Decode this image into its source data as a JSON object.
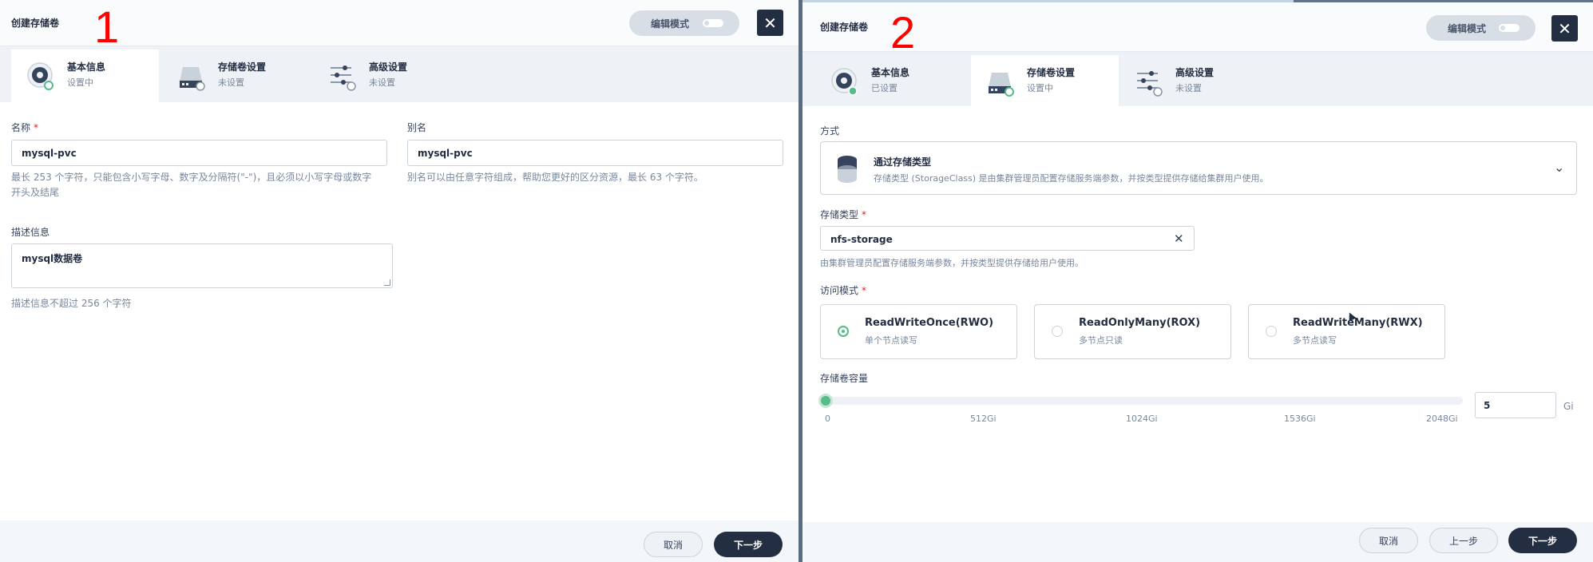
{
  "left": {
    "title": "创建存储卷",
    "marker": "1",
    "edit_mode_label": "编辑模式",
    "tabs": [
      {
        "title": "基本信息",
        "status": "设置中"
      },
      {
        "title": "存储卷设置",
        "status": "未设置"
      },
      {
        "title": "高级设置",
        "status": "未设置"
      }
    ],
    "name": {
      "label": "名称",
      "required": "*",
      "value": "mysql-pvc",
      "help_line1": "最长 253 个字符，只能包含小写字母、数字及分隔符(\"-\")，且必须以小写字母或数字",
      "help_line2": "开头及结尾"
    },
    "alias": {
      "label": "别名",
      "value": "mysql-pvc",
      "help": "别名可以由任意字符组成，帮助您更好的区分资源，最长 63 个字符。"
    },
    "description": {
      "label": "描述信息",
      "value": "mysql数据卷",
      "help": "描述信息不超过 256 个字符"
    },
    "footer": {
      "cancel": "取消",
      "next": "下一步"
    }
  },
  "right": {
    "title": "创建存储卷",
    "marker": "2",
    "edit_mode_label": "编辑模式",
    "tabs": [
      {
        "title": "基本信息",
        "status": "已设置"
      },
      {
        "title": "存储卷设置",
        "status": "设置中"
      },
      {
        "title": "高级设置",
        "status": "未设置"
      }
    ],
    "method": {
      "label": "方式",
      "title": "通过存储类型",
      "desc": "存储类型 (StorageClass) 是由集群管理员配置存储服务端参数，并按类型提供存储给集群用户使用。"
    },
    "storage_class": {
      "label": "存储类型",
      "required": "*",
      "value": "nfs-storage",
      "help": "由集群管理员配置存储服务端参数，并按类型提供存储给用户使用。"
    },
    "access_mode": {
      "label": "访问模式",
      "required": "*",
      "options": [
        {
          "title": "ReadWriteOnce(RWO)",
          "desc": "单个节点读写",
          "selected": true
        },
        {
          "title": "ReadOnlyMany(ROX)",
          "desc": "多节点只读",
          "selected": false
        },
        {
          "title": "ReadWriteMany(RWX)",
          "desc": "多节点读写",
          "selected": false
        }
      ]
    },
    "capacity": {
      "label": "存储卷容量",
      "ticks": [
        "0",
        "512Gi",
        "1024Gi",
        "1536Gi",
        "2048Gi"
      ],
      "value": "5",
      "unit": "Gi"
    },
    "footer": {
      "cancel": "取消",
      "prev": "上一步",
      "next": "下一步"
    }
  }
}
